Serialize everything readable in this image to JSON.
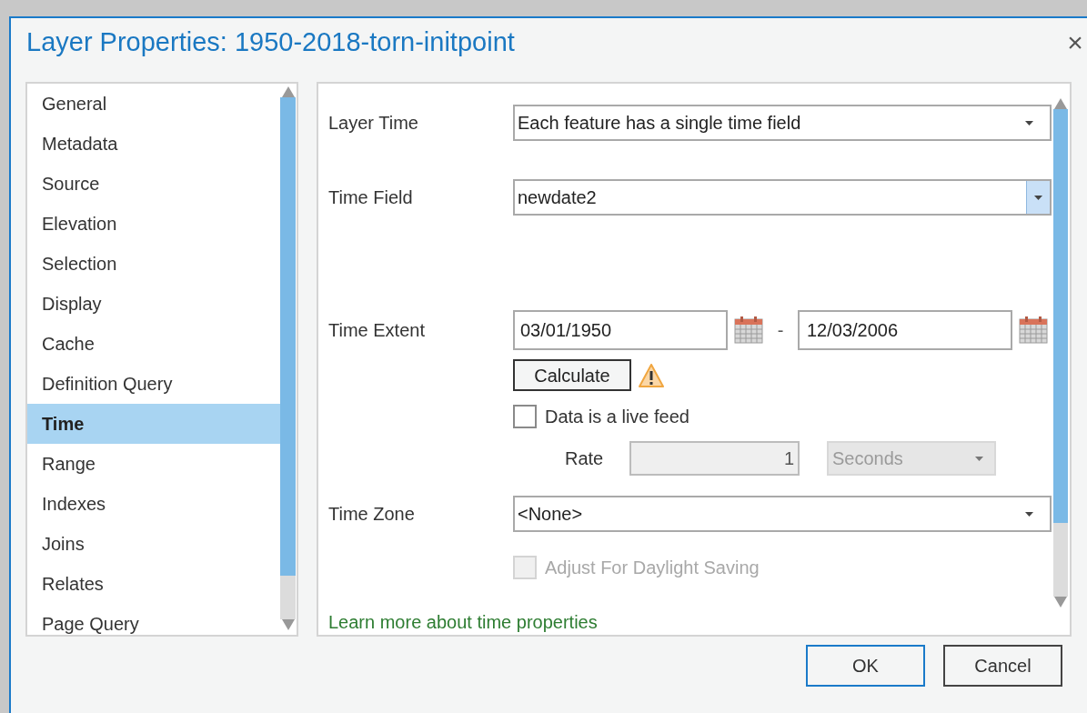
{
  "window": {
    "title": "Layer Properties: 1950-2018-torn-initpoint",
    "close": "×"
  },
  "sidebar": {
    "items": [
      {
        "label": "General",
        "selected": false
      },
      {
        "label": "Metadata",
        "selected": false
      },
      {
        "label": "Source",
        "selected": false
      },
      {
        "label": "Elevation",
        "selected": false
      },
      {
        "label": "Selection",
        "selected": false
      },
      {
        "label": "Display",
        "selected": false
      },
      {
        "label": "Cache",
        "selected": false
      },
      {
        "label": "Definition Query",
        "selected": false
      },
      {
        "label": "Time",
        "selected": true
      },
      {
        "label": "Range",
        "selected": false
      },
      {
        "label": "Indexes",
        "selected": false
      },
      {
        "label": "Joins",
        "selected": false
      },
      {
        "label": "Relates",
        "selected": false
      },
      {
        "label": "Page Query",
        "selected": false
      }
    ]
  },
  "layer_time": {
    "label": "Layer Time",
    "value": "Each feature has a single time field"
  },
  "time_field": {
    "label": "Time Field",
    "value": "newdate2",
    "hovered": true
  },
  "time_extent": {
    "label": "Time Extent",
    "start": "03/01/1950",
    "separator": "-",
    "end": "12/03/2006"
  },
  "calculate": {
    "label": "Calculate",
    "warning": true
  },
  "live_feed": {
    "label": "Data is a live feed",
    "checked": false
  },
  "rate": {
    "label": "Rate",
    "value": "1",
    "unit": "Seconds",
    "disabled": true
  },
  "time_zone": {
    "label": "Time Zone",
    "value": "<None>"
  },
  "daylight_saving": {
    "label": "Adjust For Daylight Saving",
    "checked": false,
    "disabled": true
  },
  "link": "Learn more about time properties",
  "buttons": [
    {
      "label": "OK",
      "default": true
    },
    {
      "label": "Cancel",
      "default": false
    }
  ]
}
